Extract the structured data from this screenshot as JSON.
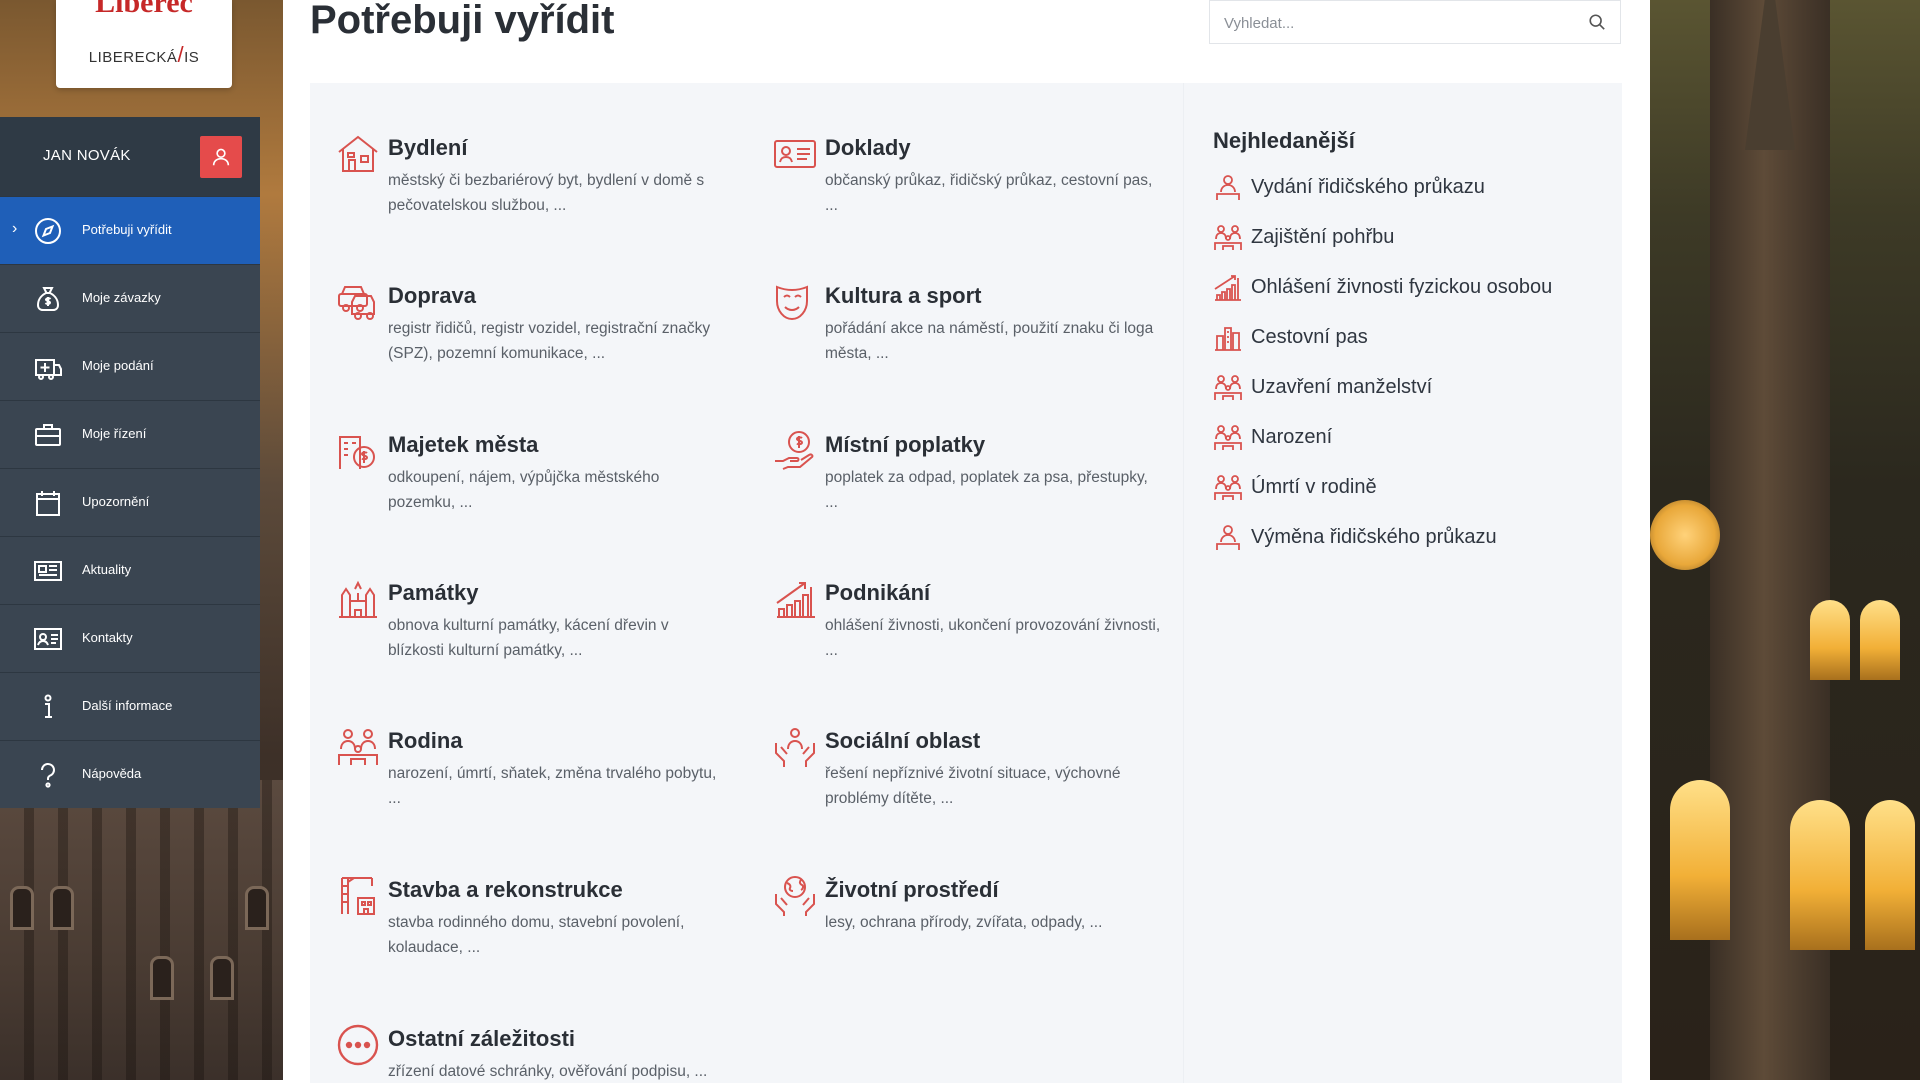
{
  "logo": {
    "city": "Liberec",
    "product_left": "LIBERECKÁ",
    "product_right": "IS"
  },
  "user": {
    "name": "JAN NOVÁK",
    "icon": "user-icon"
  },
  "nav": [
    {
      "label": "Potřebuji vyřídit",
      "icon": "compass-icon",
      "active": true
    },
    {
      "label": "Moje závazky",
      "icon": "money-bag-icon"
    },
    {
      "label": "Moje podání",
      "icon": "submission-icon"
    },
    {
      "label": "Moje řízení",
      "icon": "briefcase-icon"
    },
    {
      "label": "Upozornění",
      "icon": "calendar-icon"
    },
    {
      "label": "Aktuality",
      "icon": "news-icon"
    },
    {
      "label": "Kontakty",
      "icon": "contact-card-icon"
    },
    {
      "label": "Další informace",
      "icon": "info-icon"
    },
    {
      "label": "Nápověda",
      "icon": "help-icon"
    }
  ],
  "page": {
    "title": "Potřebuji vyřídit"
  },
  "search": {
    "placeholder": "Vyhledat...",
    "value": ""
  },
  "categories": [
    {
      "title": "Bydlení",
      "desc": "městský či bezbariérový byt, bydlení v domě s pečovatelskou službou, ...",
      "icon": "house-icon"
    },
    {
      "title": "Doklady",
      "desc": "občanský průkaz, řidičský průkaz, cestovní pas, ...",
      "icon": "id-card-icon"
    },
    {
      "title": "Doprava",
      "desc": "registr řidičů, registr vozidel, registrační značky (SPZ), pozemní komunikace, ...",
      "icon": "car-icon"
    },
    {
      "title": "Kultura a sport",
      "desc": "pořádání akce na náměstí, použití znaku či loga města, ...",
      "icon": "theater-mask-icon"
    },
    {
      "title": "Majetek města",
      "desc": "odkoupení, nájem, výpůjčka městského pozemku, ...",
      "icon": "property-icon"
    },
    {
      "title": "Místní poplatky",
      "desc": "poplatek za odpad, poplatek za psa, přestupky, ...",
      "icon": "hand-coin-icon"
    },
    {
      "title": "Památky",
      "desc": "obnova kulturní památky, kácení dřevin v blízkosti kulturní památky, ...",
      "icon": "monument-icon"
    },
    {
      "title": "Podnikání",
      "desc": "ohlášení živnosti, ukončení provozování živnosti, ...",
      "icon": "growth-chart-icon"
    },
    {
      "title": "Rodina",
      "desc": "narození, úmrtí, sňatek, změna trvalého pobytu, ...",
      "icon": "family-icon"
    },
    {
      "title": "Sociální oblast",
      "desc": "řešení nepříznivé životní situace, výchovné problémy dítěte, ...",
      "icon": "care-hands-icon"
    },
    {
      "title": "Stavba a rekonstrukce",
      "desc": "stavba rodinného domu, stavební povolení, kolaudace, ...",
      "icon": "crane-icon"
    },
    {
      "title": "Životní prostředí",
      "desc": "lesy, ochrana přírody, zvířata, odpady, ...",
      "icon": "globe-hands-icon"
    },
    {
      "title": "Ostatní záležitosti",
      "desc": "zřízení datové schránky, ověřování podpisu, ...",
      "icon": "more-icon"
    }
  ],
  "popular": {
    "title": "Nejhledanější",
    "items": [
      {
        "label": "Vydání řidičského průkazu",
        "icon": "person-icon"
      },
      {
        "label": "Zajištění pohřbu",
        "icon": "family-icon"
      },
      {
        "label": "Ohlášení živnosti fyzickou osobou",
        "icon": "growth-chart-icon"
      },
      {
        "label": "Cestovní pas",
        "icon": "building-icon"
      },
      {
        "label": "Uzavření manželství",
        "icon": "family-icon"
      },
      {
        "label": "Narození",
        "icon": "family-icon"
      },
      {
        "label": "Úmrtí v rodině",
        "icon": "family-icon"
      },
      {
        "label": "Výměna řidičského průkazu",
        "icon": "person-icon"
      }
    ]
  },
  "colors": {
    "accent": "#e54b4b",
    "nav_bg": "#3a4551",
    "nav_active": "#1f5fb8",
    "panel_bg": "#f4f6f9"
  }
}
